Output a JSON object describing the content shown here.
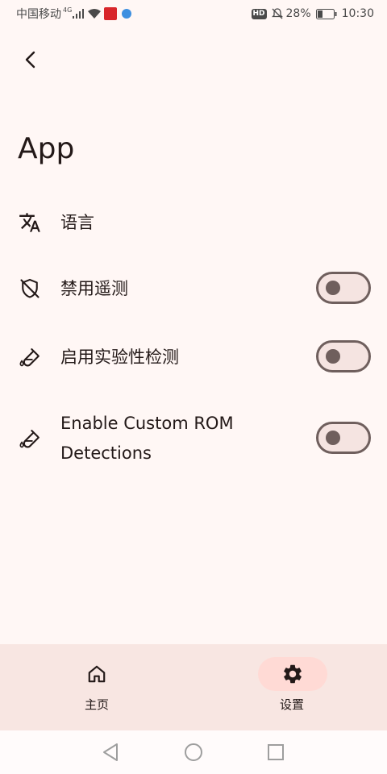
{
  "status_bar": {
    "carrier": "中国移动",
    "network_type": "4G",
    "hd_badge": "HD",
    "battery_percent": "28%",
    "time": "10:30"
  },
  "header": {
    "title": "App"
  },
  "settings": {
    "items": [
      {
        "label": "语言",
        "icon": "translate-icon"
      },
      {
        "label": "禁用遥测",
        "icon": "shield-off-icon",
        "toggle": false
      },
      {
        "label": "启用实验性检测",
        "icon": "test-tube-icon",
        "toggle": false
      },
      {
        "label_line1": "Enable Custom ROM",
        "label_line2": "Detections",
        "icon": "test-tube-icon",
        "toggle": false
      }
    ]
  },
  "bottom_nav": {
    "items": [
      {
        "label": "主页",
        "icon": "home-icon",
        "active": false
      },
      {
        "label": "设置",
        "icon": "gear-icon",
        "active": true
      }
    ]
  },
  "colors": {
    "background": "#fff7f5",
    "text": "#231918",
    "nav_background": "#f8e6e2",
    "active_indicator": "#ffdad5",
    "toggle_outline": "#6f5f5d",
    "toggle_track": "#f5e4e1"
  }
}
